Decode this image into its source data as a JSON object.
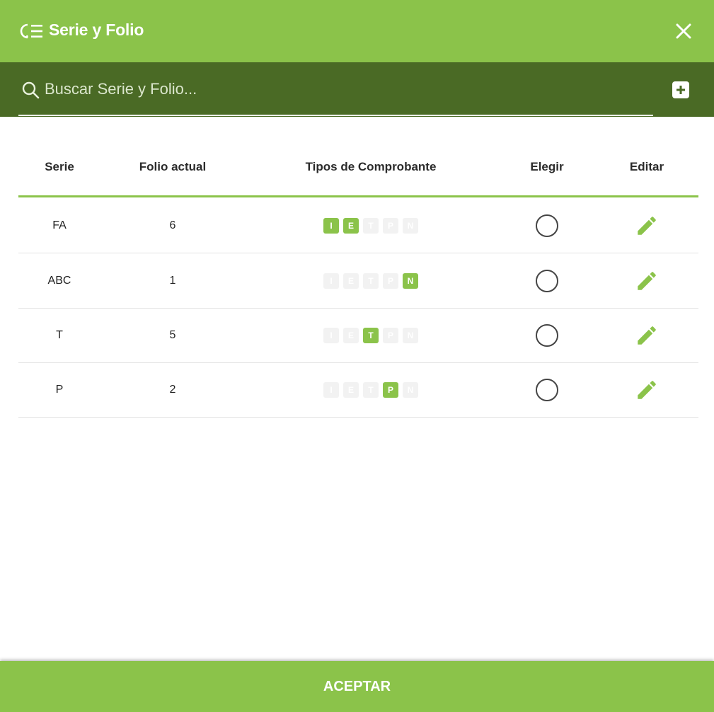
{
  "dialog": {
    "title": "Serie y Folio",
    "title_icon": "filter-list-icon",
    "close_icon": "close-icon"
  },
  "search": {
    "placeholder": "Buscar Serie y Folio...",
    "value": "",
    "add_icon": "plus-square-icon"
  },
  "table": {
    "headers": {
      "serie": "Serie",
      "folio": "Folio actual",
      "tipos": "Tipos de Comprobante",
      "elegir": "Elegir",
      "editar": "Editar"
    },
    "rows": [
      {
        "serie": "FA",
        "folio": "6",
        "tipos": [
          {
            "label": "I",
            "active": true
          },
          {
            "label": "E",
            "active": true
          },
          {
            "label": "T",
            "active": false
          },
          {
            "label": "P",
            "active": false
          },
          {
            "label": "N",
            "active": false
          }
        ],
        "selected": false
      },
      {
        "serie": "ABC",
        "folio": "1",
        "tipos": [
          {
            "label": "I",
            "active": false
          },
          {
            "label": "E",
            "active": false
          },
          {
            "label": "T",
            "active": false
          },
          {
            "label": "P",
            "active": false
          },
          {
            "label": "N",
            "active": true
          }
        ],
        "selected": false
      },
      {
        "serie": "T",
        "folio": "5",
        "tipos": [
          {
            "label": "I",
            "active": false
          },
          {
            "label": "E",
            "active": false
          },
          {
            "label": "T",
            "active": true
          },
          {
            "label": "P",
            "active": false
          },
          {
            "label": "N",
            "active": false
          }
        ],
        "selected": false
      },
      {
        "serie": "P",
        "folio": "2",
        "tipos": [
          {
            "label": "I",
            "active": false
          },
          {
            "label": "E",
            "active": false
          },
          {
            "label": "T",
            "active": false
          },
          {
            "label": "P",
            "active": true
          },
          {
            "label": "N",
            "active": false
          }
        ],
        "selected": false
      }
    ]
  },
  "footer": {
    "accept_label": "ACEPTAR"
  },
  "colors": {
    "accent": "#8bc34a",
    "search_bar": "#4a6a25",
    "badge_off": "#f2f2f2"
  }
}
